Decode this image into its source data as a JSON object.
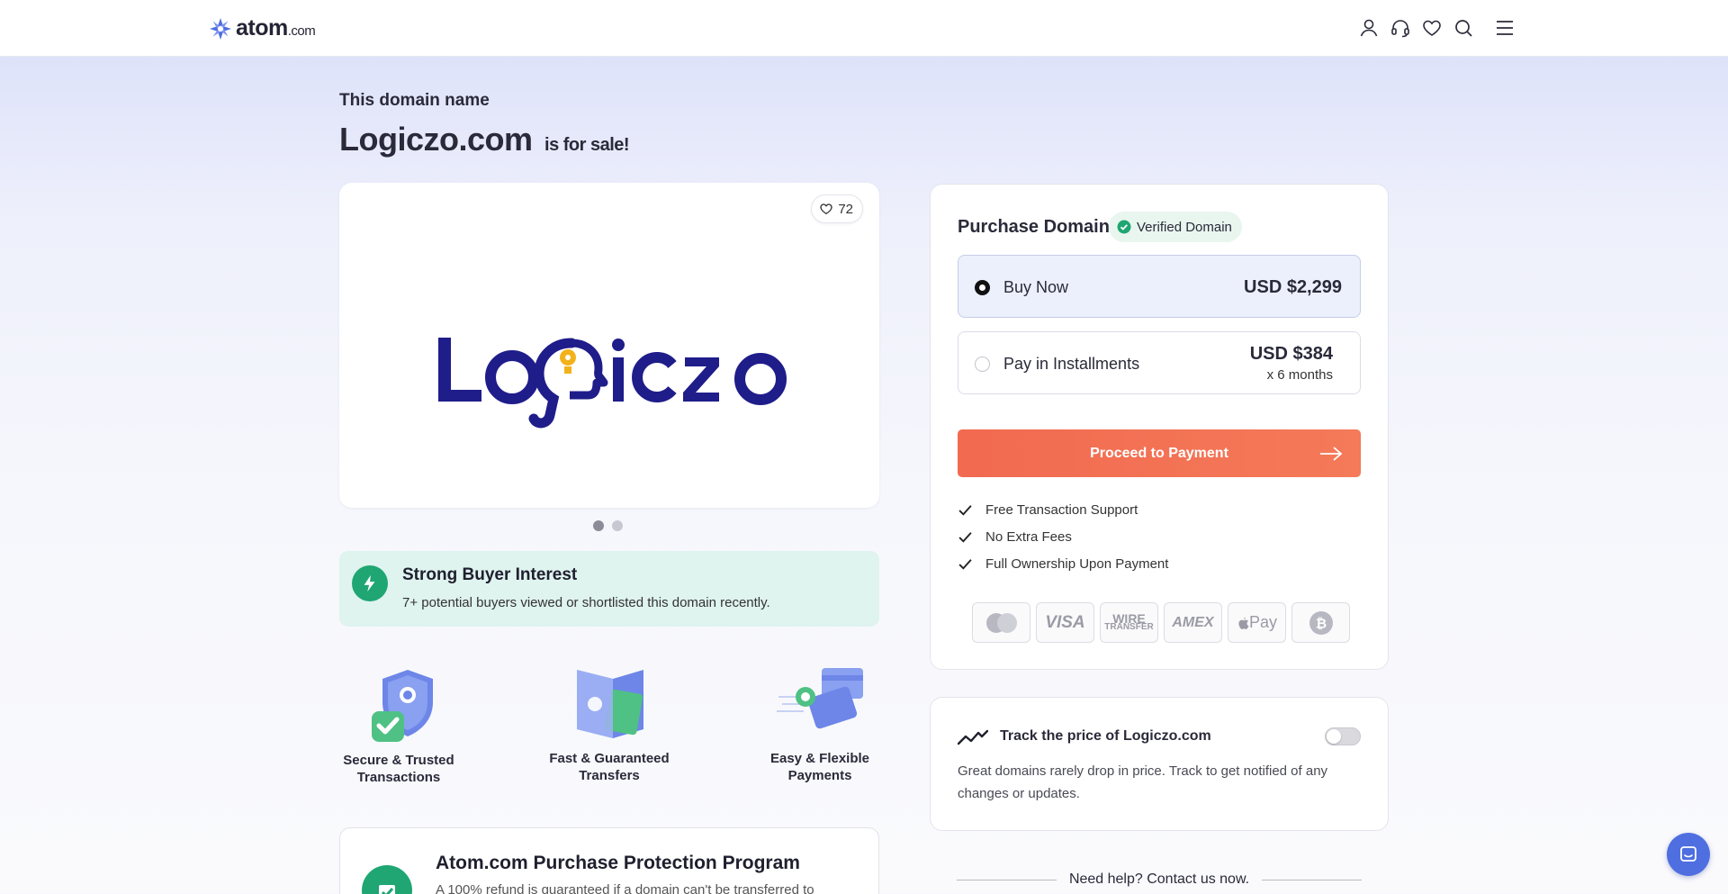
{
  "header": {
    "brand_name": "atom",
    "brand_suffix": ".com",
    "icons": [
      "user-icon",
      "headset-icon",
      "heart-icon",
      "search-icon",
      "menu-icon"
    ]
  },
  "headline": {
    "intro": "This domain name",
    "domain": "Logiczo.com",
    "suffix": "is for sale!"
  },
  "gallery": {
    "likes": "72",
    "logo_text": "Logiczo",
    "slides": 2,
    "active_slide": 1
  },
  "interest": {
    "title": "Strong Buyer Interest",
    "text": "7+ potential buyers viewed or shortlisted this domain recently."
  },
  "features": [
    {
      "label_line1": "Secure & Trusted",
      "label_line2": "Transactions"
    },
    {
      "label_line1": "Fast & Guaranteed",
      "label_line2": "Transfers"
    },
    {
      "label_line1": "Easy & Flexible",
      "label_line2": "Payments"
    }
  ],
  "protection": {
    "title": "Atom.com Purchase Protection Program",
    "text": "A 100% refund is guaranteed if a domain can't be transferred to"
  },
  "purchase": {
    "title": "Purchase Domain",
    "verified_label": "Verified Domain",
    "options": [
      {
        "label": "Buy Now",
        "price": "USD $2,299",
        "selected": true
      },
      {
        "label": "Pay in Installments",
        "price": "USD $384",
        "sub": "x 6 months",
        "selected": false
      }
    ],
    "proceed_label": "Proceed to Payment",
    "benefits": [
      "Free Transaction Support",
      "No Extra Fees",
      "Full Ownership Upon Payment"
    ],
    "payment_methods": [
      "mastercard-icon",
      "visa-icon",
      "wire-transfer-icon",
      "amex-icon",
      "apple-pay-icon",
      "bitcoin-icon"
    ],
    "payment_labels": {
      "visa": "VISA",
      "wire1": "WIRE",
      "wire2": "TRANSFER",
      "amex": "AMEX",
      "applepay": "Pay"
    }
  },
  "track": {
    "title": "Track the price of Logiczo.com",
    "text": "Great domains rarely drop in price. Track to get notified of any changes or updates.",
    "enabled": false
  },
  "help": {
    "text": "Need help? Contact us now."
  },
  "colors": {
    "accent": "#f26a50",
    "brand_navy": "#1f1d8a",
    "brand_gold": "#f2b21c",
    "success": "#1fa672",
    "atom_blue": "#4f6fe0"
  }
}
